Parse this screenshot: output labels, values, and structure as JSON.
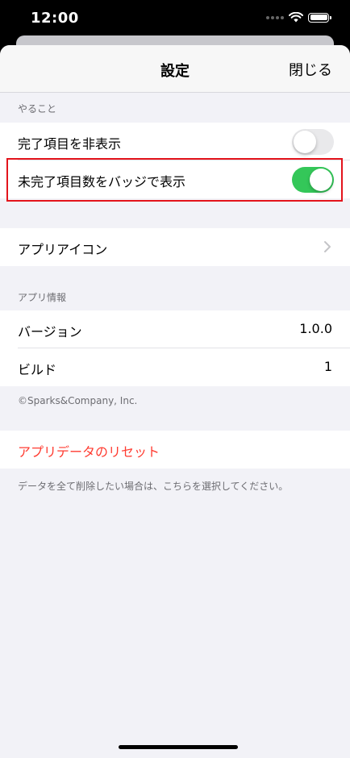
{
  "status": {
    "time": "12:00"
  },
  "nav": {
    "title": "設定",
    "close_label": "閉じる"
  },
  "todo_section": {
    "header": "やること",
    "rows": [
      {
        "label": "完了項目を非表示",
        "enabled": false
      },
      {
        "label": "未完了項目数をバッジで表示",
        "enabled": true
      }
    ]
  },
  "icon_section": {
    "label": "アプリアイコン"
  },
  "info_section": {
    "header": "アプリ情報",
    "rows": [
      {
        "label": "バージョン",
        "value": "1.0.0"
      },
      {
        "label": "ビルド",
        "value": "1"
      }
    ],
    "copyright": "©Sparks&Company, Inc."
  },
  "reset_section": {
    "label": "アプリデータのリセット",
    "note": "データを全て削除したい場合は、こちらを選択してください。"
  },
  "colors": {
    "toggle_on": "#34c759",
    "destructive": "#ff3b30",
    "highlight": "#e3141c"
  }
}
